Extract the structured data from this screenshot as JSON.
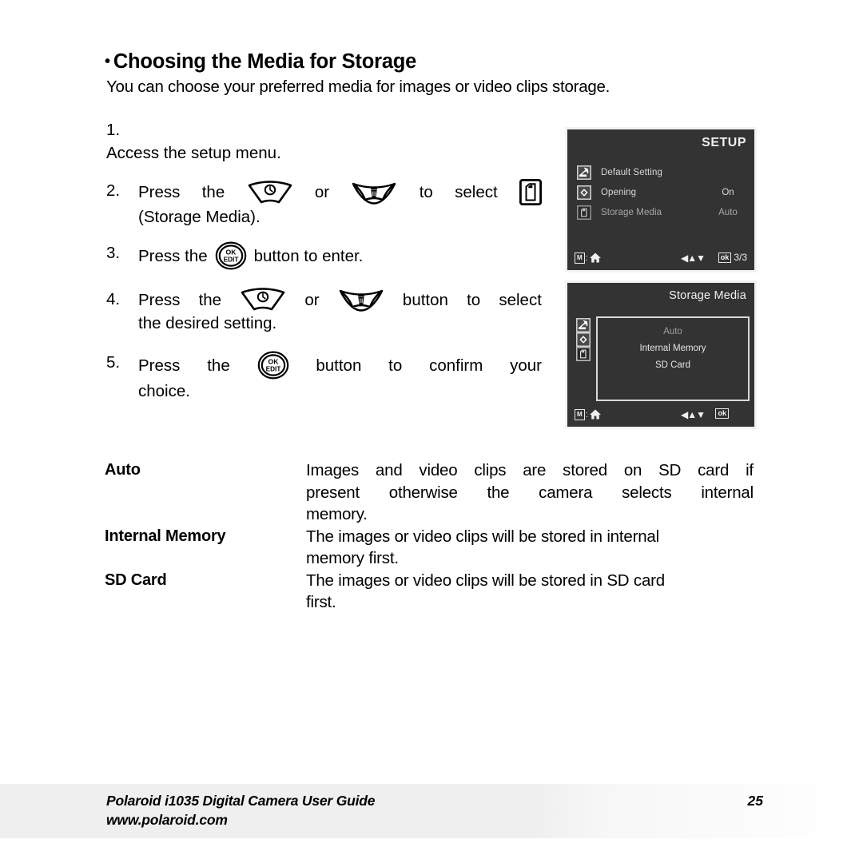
{
  "section": {
    "bullet": "•",
    "heading": "Choosing the Media for Storage",
    "intro": "You can choose your preferred media for images or video clips storage."
  },
  "steps": [
    {
      "num": "1.",
      "line1_a": "Access the setup menu.",
      "type": "plain"
    },
    {
      "num": "2.",
      "type": "icons_select",
      "t1": "Press",
      "t2": "the",
      "icon1": "timer-fan-button-icon",
      "t3": "or",
      "icon2": "trash-fan-button-icon",
      "t4": "to",
      "t5": "select",
      "icon3": "storage-media-card-icon",
      "line2": "(Storage Media)."
    },
    {
      "num": "3.",
      "type": "ok_enter",
      "t1": "Press the",
      "icon1": "ok-edit-button-icon",
      "t2": "button to enter."
    },
    {
      "num": "4.",
      "type": "icons_setting",
      "t1": "Press",
      "t2": "the",
      "icon1": "timer-fan-button-icon",
      "t3": "or",
      "icon2": "trash-fan-button-icon",
      "t4": "button",
      "t5": "to",
      "t6": "select",
      "line2": "the desired setting."
    },
    {
      "num": "5.",
      "type": "ok_confirm",
      "t1": "Press",
      "t2": "the",
      "icon1": "ok-edit-button-icon",
      "t3": "button",
      "t4": "to",
      "t5": "confirm",
      "t6": "your",
      "line2": "choice."
    }
  ],
  "lcd_setup": {
    "title": "SETUP",
    "items": [
      {
        "icon": "wrench-default-setting-icon",
        "label": "Default Setting",
        "value": ""
      },
      {
        "icon": "diamond-opening-icon",
        "label": "Opening",
        "value": "On"
      },
      {
        "icon": "storage-media-card-icon",
        "label": "Storage Media",
        "value": "Auto"
      }
    ],
    "bar": {
      "mode_badge": "M",
      "colon": ":",
      "home_icon": "home-icon",
      "arrows": "◀▲▼",
      "ok_badge": "ok",
      "page_count": "3/3"
    }
  },
  "lcd_storage": {
    "title": "Storage Media",
    "rail_icons": [
      "wrench-default-setting-icon",
      "diamond-opening-icon",
      "storage-media-card-icon"
    ],
    "options": [
      "Auto",
      "Internal Memory",
      "SD Card"
    ],
    "bar": {
      "mode_badge": "M",
      "colon": ":",
      "home_icon": "home-icon",
      "arrows": "◀▲▼",
      "ok_badge": "ok"
    }
  },
  "definitions": [
    {
      "term": "Auto",
      "lines": [
        "Images and video clips are stored on SD card if",
        "present otherwise the camera selects internal",
        "memory."
      ]
    },
    {
      "term": "Internal Memory",
      "lines": [
        "The images or video clips will be stored in internal",
        "memory first."
      ]
    },
    {
      "term": "SD Card",
      "lines": [
        "The images or video clips will be stored in SD card",
        "first."
      ]
    }
  ],
  "footer": {
    "line1": "Polaroid i1035 Digital Camera User Guide",
    "line2": "www.polaroid.com",
    "page": "25"
  },
  "colors": {
    "lcd_bg": "#333333",
    "lcd_border": "#f2f2f2",
    "lcd_text": "#e8e8e8",
    "lcd_dim_text": "#a8a8a8",
    "page_bg": "#ffffff",
    "ink": "#000000",
    "footer_band": "#efefef"
  }
}
